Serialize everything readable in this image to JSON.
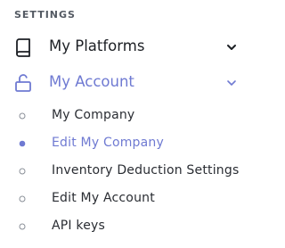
{
  "sidebar": {
    "section_title": "SETTINGS",
    "groups": [
      {
        "label": "My Platforms",
        "icon": "book-icon",
        "expanded": false
      },
      {
        "label": "My Account",
        "icon": "unlock-icon",
        "expanded": true
      }
    ],
    "account_items": [
      {
        "label": "My Company",
        "active": false
      },
      {
        "label": "Edit My Company",
        "active": true
      },
      {
        "label": "Inventory Deduction Settings",
        "active": false
      },
      {
        "label": "Edit My Account",
        "active": false
      },
      {
        "label": "API keys",
        "active": false
      }
    ]
  },
  "colors": {
    "accent": "#6f7ad2",
    "text": "#2a2d33",
    "section": "#545a63"
  }
}
